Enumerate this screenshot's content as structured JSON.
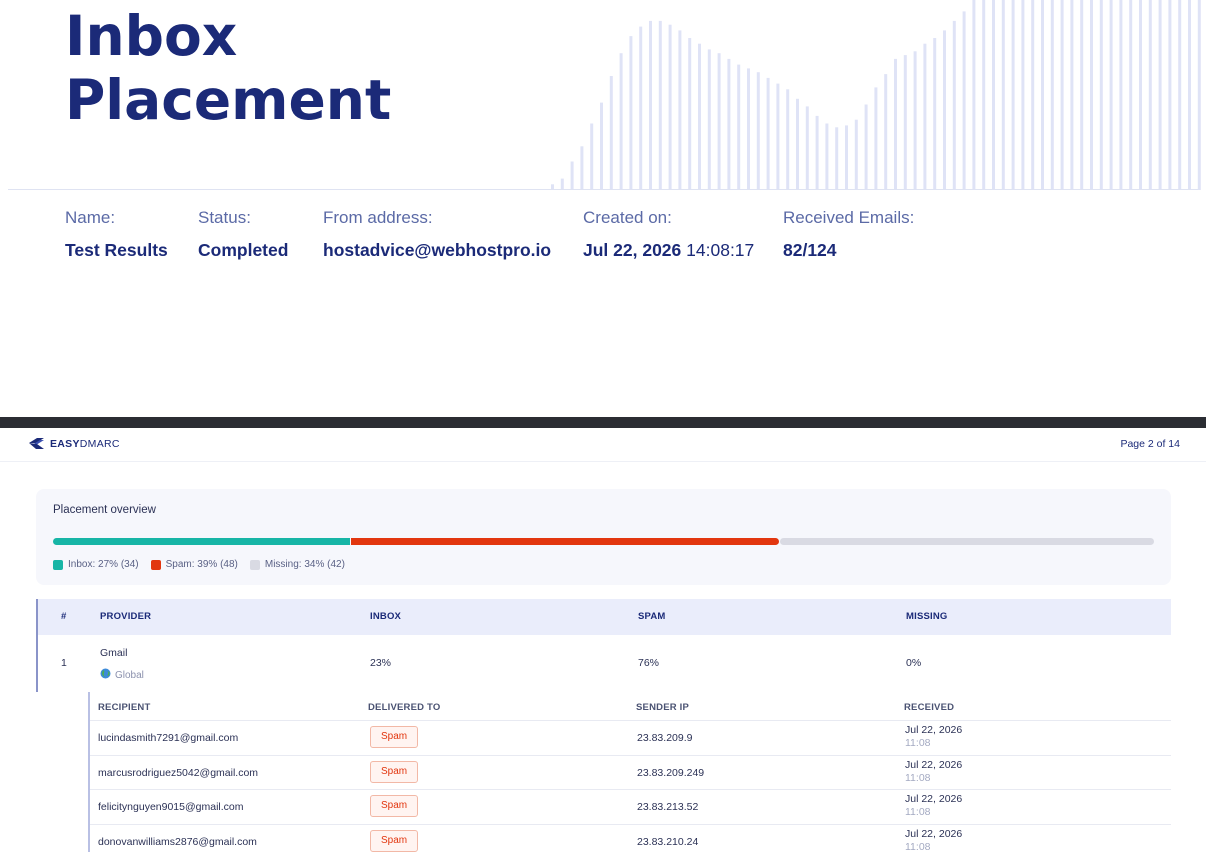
{
  "cover": {
    "title_line1": "Inbox",
    "title_line2": "Placement",
    "meta": {
      "name_label": "Name:",
      "name_value": "Test Results",
      "status_label": "Status:",
      "status_value": "Completed",
      "from_label": "From address:",
      "from_value": "hostadvice@webhostpro.io",
      "created_label": "Created on:",
      "created_date": "Jul 22, 2026",
      "created_time": "14:08:17",
      "received_label": "Received Emails:",
      "received_value": "82/124"
    },
    "decor_bar_levels": [
      0.03,
      0.06,
      0.15,
      0.23,
      0.35,
      0.46,
      0.6,
      0.72,
      0.81,
      0.86,
      0.89,
      0.89,
      0.87,
      0.84,
      0.8,
      0.77,
      0.74,
      0.72,
      0.69,
      0.66,
      0.64,
      0.62,
      0.59,
      0.56,
      0.53,
      0.48,
      0.44,
      0.39,
      0.35,
      0.33,
      0.34,
      0.37,
      0.45,
      0.54,
      0.61,
      0.69,
      0.71,
      0.73,
      0.77,
      0.8,
      0.84,
      0.89,
      0.94,
      1,
      1,
      1,
      1,
      1,
      1,
      1,
      1,
      1,
      1,
      1,
      1,
      1,
      1,
      1,
      1,
      1,
      1,
      1,
      1,
      1,
      1,
      1,
      1
    ],
    "decor_color": "#dfe3f6"
  },
  "page2": {
    "logo_bold": "EASY",
    "logo_rest": "DMARC",
    "page_label": "Page 2 of 14",
    "overview": {
      "title": "Placement overview",
      "inbox_fraction": 0.27,
      "spam_fraction": 0.39,
      "missing_fraction": 0.34,
      "inbox_legend": "Inbox: 27% (34)",
      "spam_legend": "Spam: 39% (48)",
      "missing_legend": "Missing: 34% (42)",
      "colors": {
        "inbox": "#17b5a6",
        "spam": "#e2360f",
        "missing": "#d9dae3"
      }
    },
    "providers": {
      "headers": {
        "num": "#",
        "provider": "PROVIDER",
        "inbox": "INBOX",
        "spam": "SPAM",
        "missing": "MISSING"
      },
      "rows": [
        {
          "num": "1",
          "name": "Gmail",
          "region": "Global",
          "inbox": "23%",
          "spam": "76%",
          "missing": "0%"
        }
      ]
    },
    "recipients": {
      "headers": {
        "recipient": "RECIPIENT",
        "delivered": "DELIVERED TO",
        "ip": "SENDER IP",
        "received": "RECEIVED"
      },
      "rows": [
        {
          "email": "lucindasmith7291@gmail.com",
          "delivered": "Spam",
          "ip": "23.83.209.9",
          "date": "Jul 22, 2026",
          "time": "11:08"
        },
        {
          "email": "marcusrodriguez5042@gmail.com",
          "delivered": "Spam",
          "ip": "23.83.209.249",
          "date": "Jul 22, 2026",
          "time": "11:08"
        },
        {
          "email": "felicitynguyen9015@gmail.com",
          "delivered": "Spam",
          "ip": "23.83.213.52",
          "date": "Jul 22, 2026",
          "time": "11:08"
        },
        {
          "email": "donovanwilliams2876@gmail.com",
          "delivered": "Spam",
          "ip": "23.83.210.24",
          "date": "Jul 22, 2026",
          "time": "11:08"
        }
      ]
    }
  }
}
